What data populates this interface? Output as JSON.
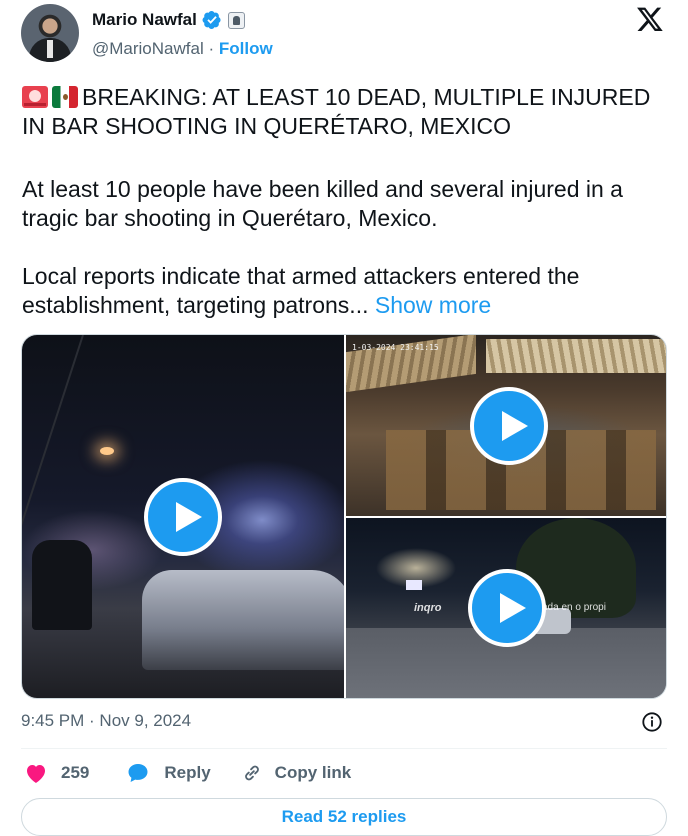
{
  "author": {
    "name": "Mario Nawfal",
    "handle": "@MarioNawfal",
    "separator": "·",
    "follow_label": "Follow"
  },
  "icons": {
    "verified": "verified-badge-icon",
    "affiliate": "affiliate-badge-icon",
    "platform": "x-logo-icon",
    "siren": "police-siren-emoji",
    "flag": "mexico-flag-emoji",
    "info": "info-icon",
    "like": "heart-icon",
    "reply": "speech-bubble-icon",
    "copy": "link-icon"
  },
  "tweet": {
    "headline": "BREAKING: AT LEAST 10 DEAD, MULTIPLE INJURED IN BAR SHOOTING IN QUERÉTARO, MEXICO",
    "paragraph1": "At least 10 people have been killed and several injured in a tragic bar shooting in Querétaro, Mexico.",
    "paragraph2": "Local reports indicate that armed attackers entered the establishment, targeting patrons...",
    "show_more": "Show more"
  },
  "media": {
    "video2_timestamp": "1-03-2024  23:41:15",
    "video3_watermark": "inqro",
    "video3_caption": "ada en o propi"
  },
  "footer": {
    "timestamp": "9:45 PM · Nov 9, 2024",
    "like_count": "259",
    "reply_label": "Reply",
    "copy_label": "Copy link",
    "read_replies_label": "Read 52 replies"
  },
  "colors": {
    "accent": "#1d9bf0",
    "text": "#0f1419",
    "secondary": "#536471",
    "like": "#f91880",
    "border": "#cfd9de"
  }
}
